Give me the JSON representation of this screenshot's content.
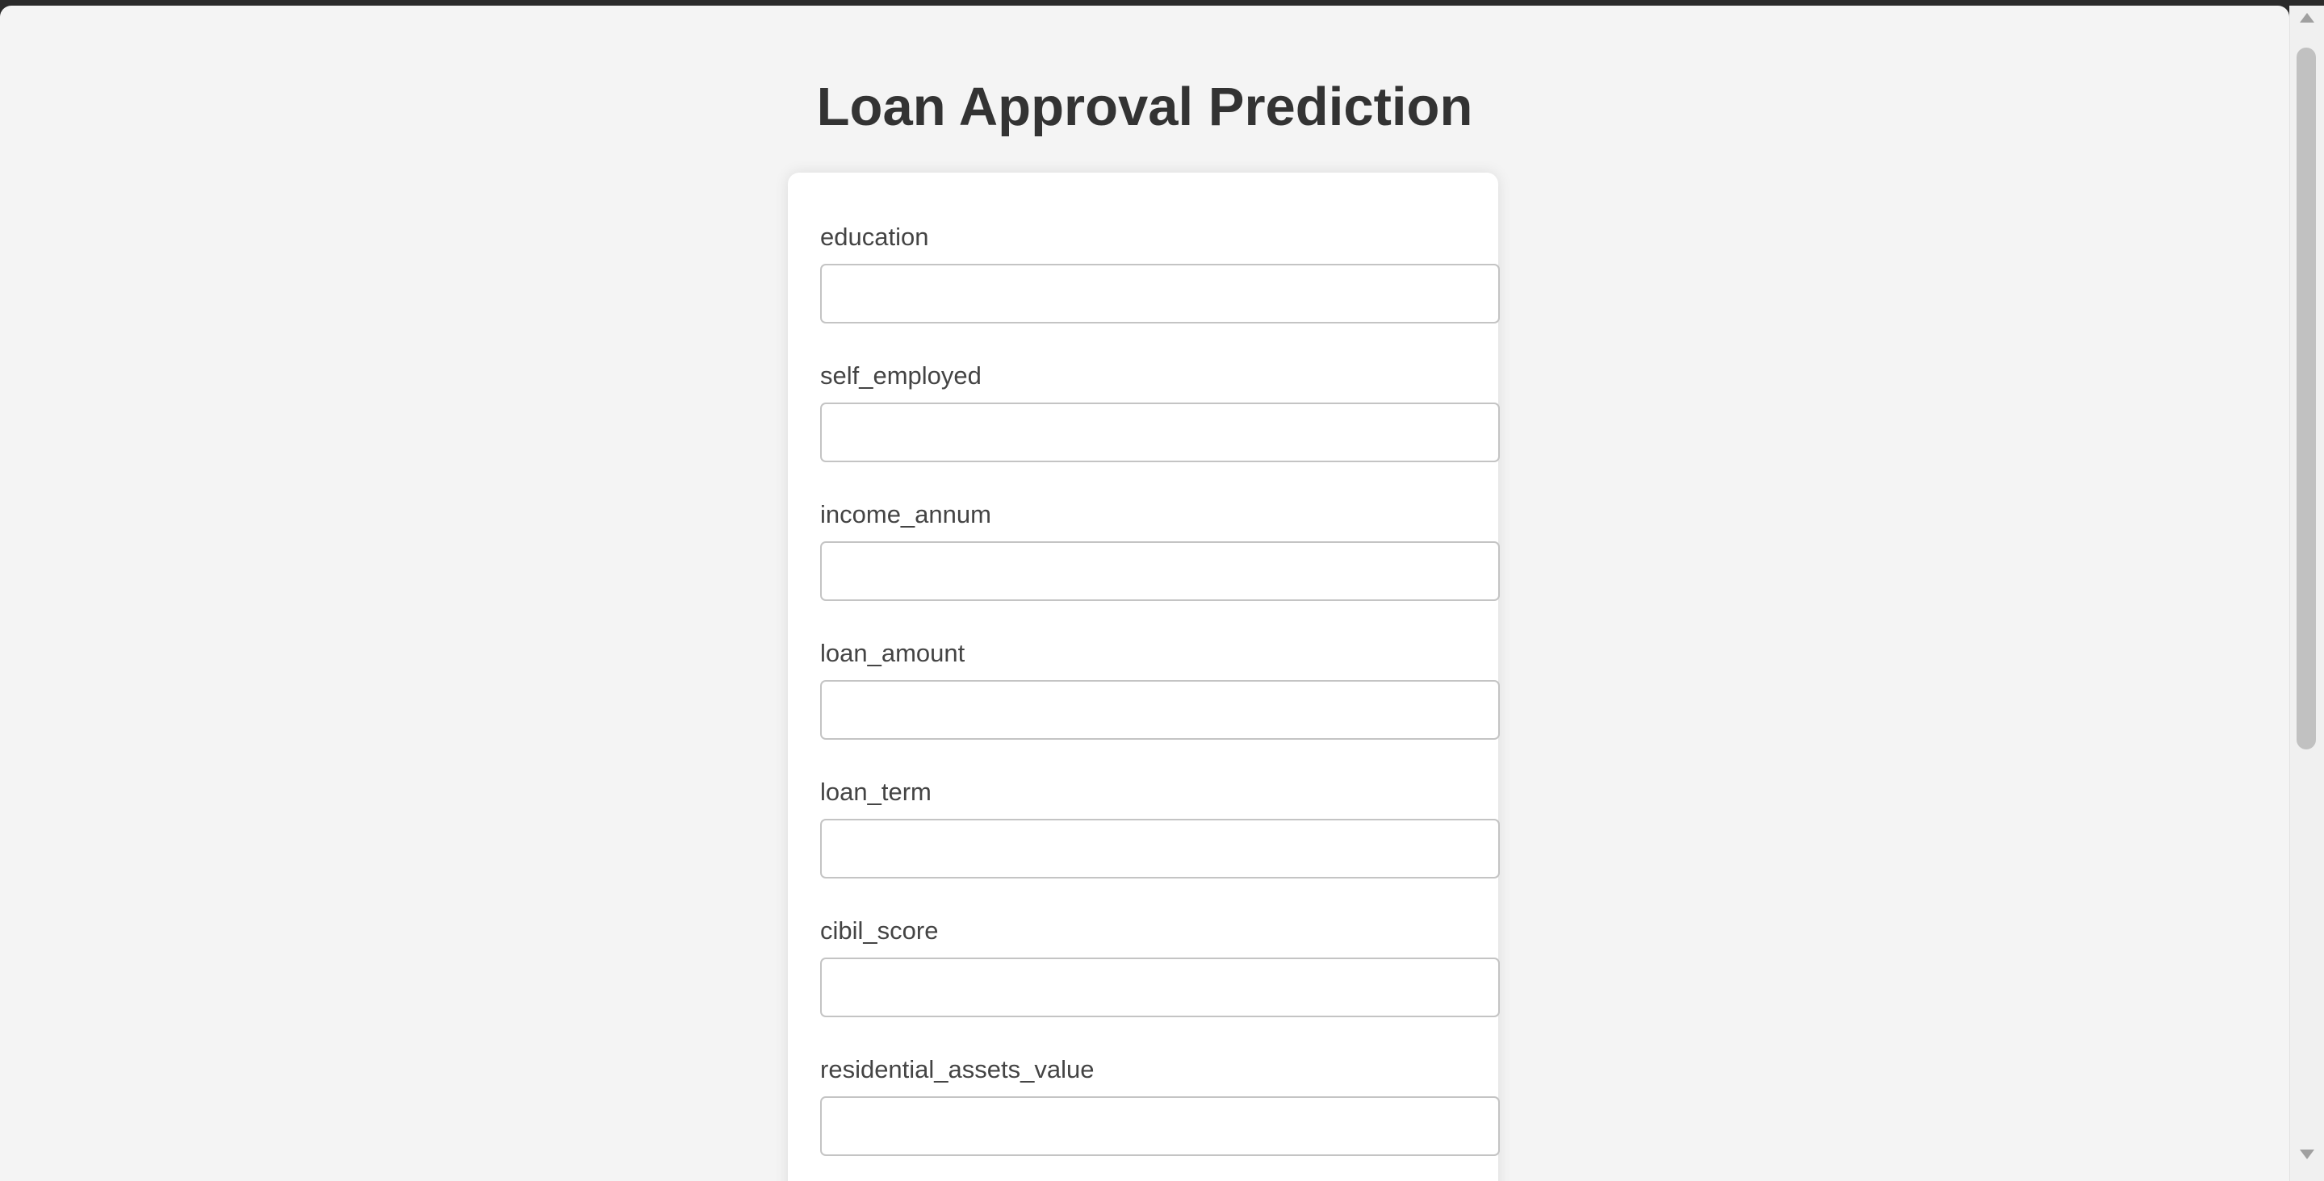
{
  "page": {
    "title": "Loan Approval Prediction"
  },
  "form": {
    "fields": [
      {
        "label": "education",
        "value": "",
        "placeholder": ""
      },
      {
        "label": "self_employed",
        "value": "",
        "placeholder": ""
      },
      {
        "label": "income_annum",
        "value": "",
        "placeholder": ""
      },
      {
        "label": "loan_amount",
        "value": "",
        "placeholder": ""
      },
      {
        "label": "loan_term",
        "value": "",
        "placeholder": ""
      },
      {
        "label": "cibil_score",
        "value": "",
        "placeholder": ""
      },
      {
        "label": "residential_assets_value",
        "value": "",
        "placeholder": ""
      }
    ]
  },
  "scrollbar": {
    "up_icon": "chevron-up-icon",
    "down_icon": "chevron-down-icon"
  },
  "colors": {
    "background": "#f4f4f4",
    "card": "#ffffff",
    "title_text": "#333333",
    "label_text": "#444444",
    "input_border": "#c4c4c4"
  }
}
